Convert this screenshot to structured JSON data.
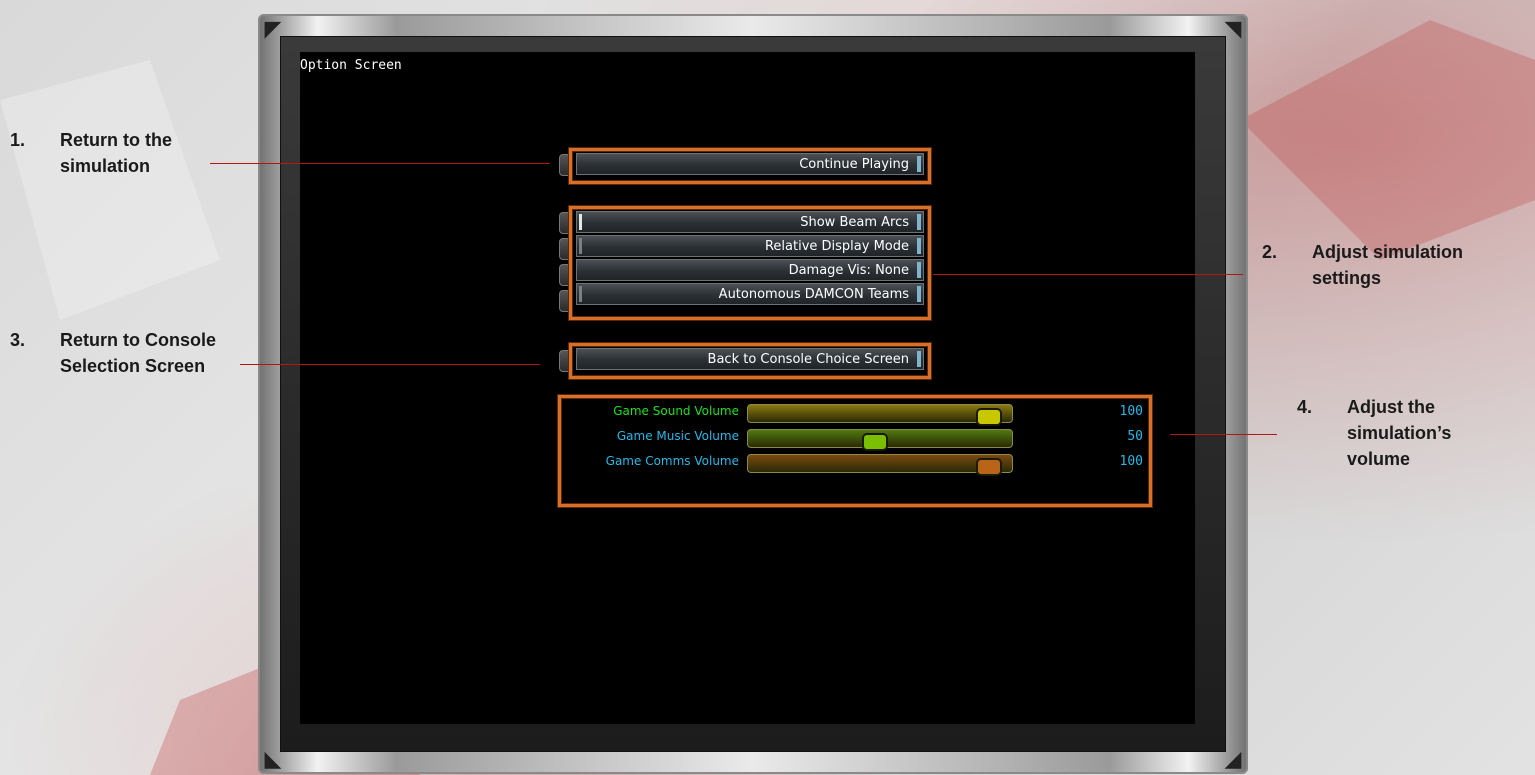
{
  "screen": {
    "title": "Option Screen"
  },
  "buttons": {
    "continue": "Continue Playing",
    "settings": [
      {
        "label": "Show Beam Arcs",
        "indicator": "on"
      },
      {
        "label": "Relative Display Mode",
        "indicator": "off"
      },
      {
        "label": "Damage Vis: None",
        "indicator": "off"
      },
      {
        "label": "Autonomous DAMCON Teams",
        "indicator": "off"
      }
    ],
    "back": "Back to Console Choice Screen"
  },
  "volumes": [
    {
      "label": "Game Sound Volume",
      "value": "100",
      "level": 1.0,
      "label_color": "#22dd22",
      "track_color": "#8a7a10",
      "knob_color": "#c8c800",
      "value_color": "#2ab8e6"
    },
    {
      "label": "Game Music Volume",
      "value": "50",
      "level": 0.5,
      "label_color": "#2ab8e6",
      "track_color": "#4f7a10",
      "knob_color": "#7ac000",
      "value_color": "#2ab8e6"
    },
    {
      "label": "Game Comms Volume",
      "value": "100",
      "level": 1.0,
      "label_color": "#2ab8e6",
      "track_color": "#7a4a10",
      "knob_color": "#b8651a",
      "value_color": "#2ab8e6"
    }
  ],
  "annotations": [
    {
      "number": "1.",
      "text_lines": [
        "Return to the",
        "simulation"
      ]
    },
    {
      "number": "2.",
      "text_lines": [
        "Adjust simulation",
        "settings"
      ]
    },
    {
      "number": "3.",
      "text_lines": [
        "Return to Console",
        "Selection Screen"
      ]
    },
    {
      "number": "4.",
      "text_lines": [
        "Adjust the",
        "simulation’s",
        "volume"
      ]
    }
  ],
  "colors": {
    "accent_frame": "#d9702a",
    "annotation_line": "#b01818"
  }
}
